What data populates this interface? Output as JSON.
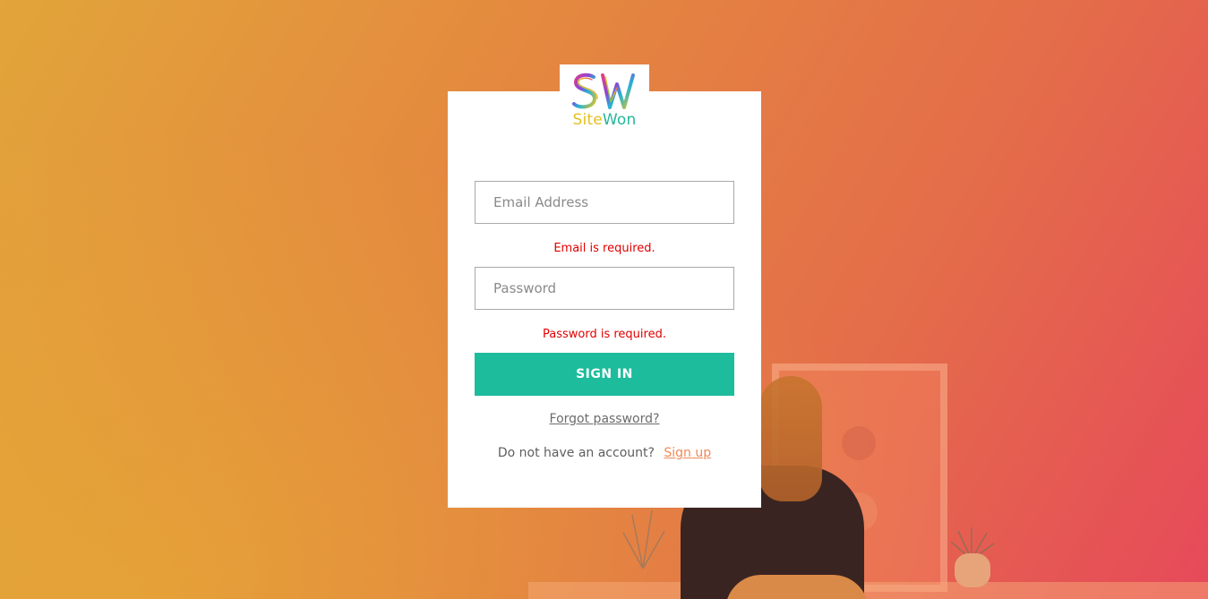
{
  "brand": {
    "name_part1": "Site",
    "name_part2": "Won",
    "monogram": "SW",
    "colors": {
      "site": "#e3c020",
      "won": "#24b79a"
    }
  },
  "login": {
    "email": {
      "placeholder": "Email Address",
      "value": "",
      "error": "Email is required."
    },
    "password": {
      "placeholder": "Password",
      "value": "",
      "error": "Password is required."
    },
    "signin_label": "SIGN IN",
    "forgot_label": "Forgot password?",
    "signup_prompt": "Do not have an account?",
    "signup_label": "Sign up"
  },
  "colors": {
    "accent": "#1dbc9c",
    "error": "#e00000",
    "link": "#ee8a58"
  }
}
